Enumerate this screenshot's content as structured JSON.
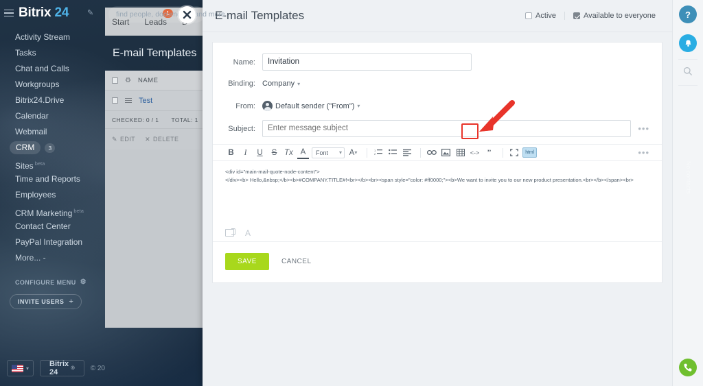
{
  "brand": {
    "name": "Bitrix",
    "suffix": "24"
  },
  "search": {
    "placeholder": "find people, documents, and more"
  },
  "sidebar": {
    "items": [
      {
        "label": "Activity Stream"
      },
      {
        "label": "Tasks"
      },
      {
        "label": "Chat and Calls"
      },
      {
        "label": "Workgroups"
      },
      {
        "label": "Bitrix24.Drive"
      },
      {
        "label": "Calendar"
      },
      {
        "label": "Webmail"
      },
      {
        "label": "CRM",
        "badge": "3",
        "active": true
      },
      {
        "label": "Sites",
        "sup": "beta"
      },
      {
        "label": "Time and Reports"
      },
      {
        "label": "Employees"
      },
      {
        "label": "CRM Marketing",
        "sup": "beta"
      },
      {
        "label": "Contact Center"
      },
      {
        "label": "PayPal Integration"
      },
      {
        "label": "More... -"
      }
    ],
    "configure_menu": "CONFIGURE MENU",
    "invite_users": "INVITE USERS",
    "invite_plus": "+"
  },
  "footer": {
    "language": "English",
    "brand_box": "Bitrix 24",
    "copyright": "© 20"
  },
  "list_panel": {
    "tabs": [
      {
        "label": "Start",
        "badge": ""
      },
      {
        "label": "Leads",
        "badge": "1"
      },
      {
        "label": "D",
        "badge": ""
      }
    ],
    "title": "E-mail Templates",
    "column_header": "NAME",
    "rows": [
      {
        "name": "Test"
      }
    ],
    "checked_text": "CHECKED: 0 / 1",
    "total_text": "TOTAL: 1",
    "actions": [
      {
        "label": "EDIT",
        "icon": "pencil-icon"
      },
      {
        "label": "DELETE",
        "icon": "close-icon"
      }
    ]
  },
  "modal": {
    "title": "E-mail Templates",
    "checkboxes": [
      {
        "label": "Active",
        "checked": false
      },
      {
        "label": "Available to everyone",
        "checked": true
      }
    ],
    "fields": {
      "name_label": "Name:",
      "name_value": "Invitation",
      "binding_label": "Binding:",
      "binding_value": "Company",
      "from_label": "From:",
      "from_value": "Default sender (\"From\")",
      "subject_label": "Subject:",
      "subject_placeholder": "Enter message subject"
    },
    "toolbar": {
      "bold": "B",
      "italic": "I",
      "underline": "U",
      "strike": "S",
      "clear_format": "Tx",
      "text_color": "A",
      "font_label": "Font",
      "font_size": "A",
      "ordered_list": "ordered-list-icon",
      "unordered_list": "unordered-list-icon",
      "align": "align-icon",
      "link": "link-icon",
      "image": "image-icon",
      "table": "table-icon",
      "code": "<->",
      "quote": "quote-icon",
      "fullscreen": "fullscreen-icon",
      "html_label": "html"
    },
    "source_lines": [
      "<div id=\"main-mail-quote-node-content\">",
      "</div><b> Hello,&nbsp;</b><b>#COMPANY.TITLE#!<br></b><br><span style=\"color: #ff0000;\"><b>We want to invite you to our new product presentation.<br></b></span><br>"
    ],
    "buttons": {
      "save": "SAVE",
      "cancel": "CANCEL"
    },
    "more_dots": "•••"
  },
  "rail": {
    "help": "?",
    "notifications": "bell-icon",
    "search": "search-icon",
    "vertical_text": "No contacts",
    "phone": "phone-icon"
  },
  "colors": {
    "accent_blue": "#4fb3e8",
    "save_green": "#a8d81c",
    "badge_orange": "#e05a2b",
    "highlight_red": "#e8342a",
    "html_btn_blue": "#bfdff2"
  }
}
